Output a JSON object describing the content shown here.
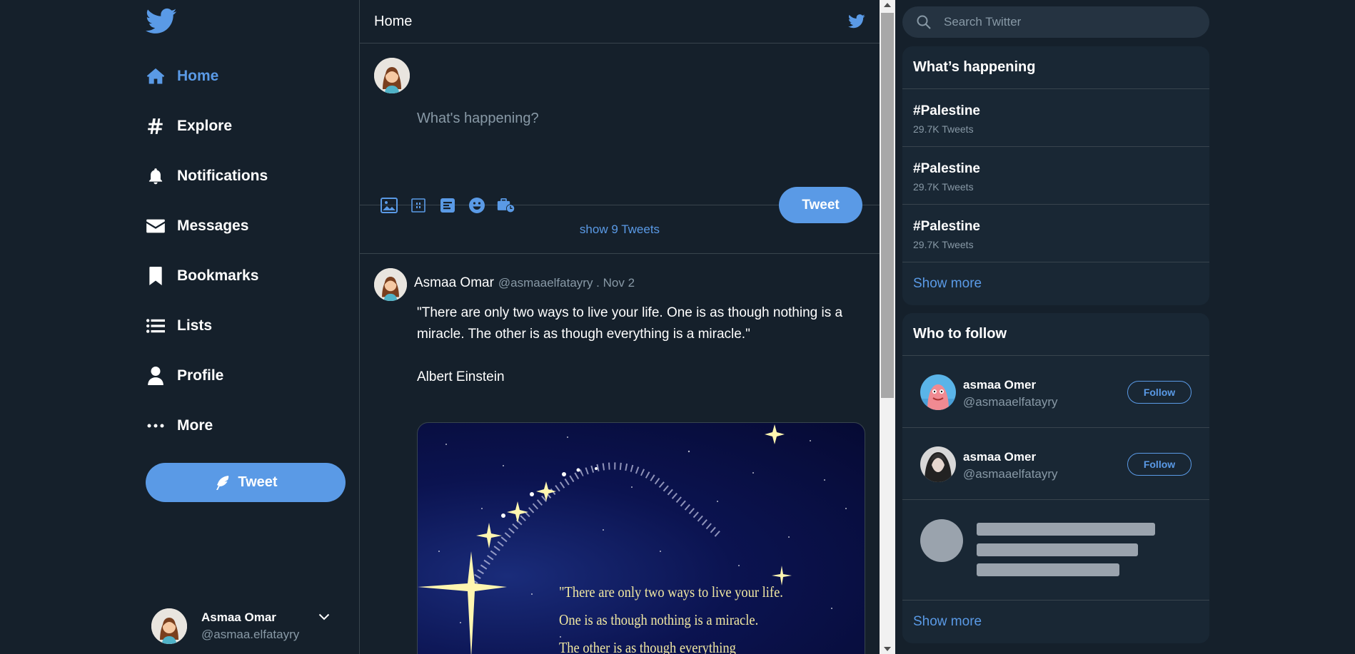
{
  "nav": {
    "items": [
      {
        "label": "Home",
        "icon": "home-icon",
        "active": true
      },
      {
        "label": "Explore",
        "icon": "hashtag-icon"
      },
      {
        "label": "Notifications",
        "icon": "bell-icon"
      },
      {
        "label": "Messages",
        "icon": "envelope-icon"
      },
      {
        "label": "Bookmarks",
        "icon": "bookmark-icon"
      },
      {
        "label": "Lists",
        "icon": "list-icon"
      },
      {
        "label": "Profile",
        "icon": "user-icon"
      },
      {
        "label": "More",
        "icon": "more-icon"
      }
    ],
    "tweet_button": "Tweet"
  },
  "account": {
    "name": "Asmaa Omar",
    "handle": "@asmaa.elfatayry"
  },
  "header": {
    "title": "Home"
  },
  "composer": {
    "placeholder": "What's happening?",
    "tweet_button": "Tweet",
    "tools": [
      "image-icon",
      "gif-icon",
      "poll-icon",
      "emoji-icon",
      "schedule-icon"
    ]
  },
  "feed": {
    "show_tweets": "show 9 Tweets",
    "tweet": {
      "author": "Asmaa Omar",
      "sub": "@asmaaelfatayry . Nov 2",
      "text": "\"There are only two ways to live your life. One is as though nothing is a miracle. The other is as though everything is a miracle.\"",
      "attribution": "Albert Einstein",
      "image_lines": [
        "\"There are only two ways to live your life.",
        "One is as though nothing is a miracle.",
        "The other is as though everything"
      ]
    }
  },
  "search": {
    "placeholder": "Search Twitter"
  },
  "trends": {
    "title": "What’s happening",
    "items": [
      {
        "tag": "#Palestine",
        "count": "29.7K Tweets"
      },
      {
        "tag": "#Palestine",
        "count": "29.7K Tweets"
      },
      {
        "tag": "#Palestine",
        "count": "29.7K Tweets"
      }
    ],
    "show_more": "Show more"
  },
  "who_to_follow": {
    "title": "Who to follow",
    "items": [
      {
        "name": "asmaa Omer",
        "handle": "@asmaaelfatayry",
        "button": "Follow"
      },
      {
        "name": "asmaa Omer",
        "handle": "@asmaaelfatayry",
        "button": "Follow"
      }
    ],
    "show_more": "Show more"
  },
  "colors": {
    "background": "#15202b",
    "panel": "#192734",
    "accent": "#5a9ae6",
    "muted": "#8899a6",
    "border": "#38444d"
  }
}
